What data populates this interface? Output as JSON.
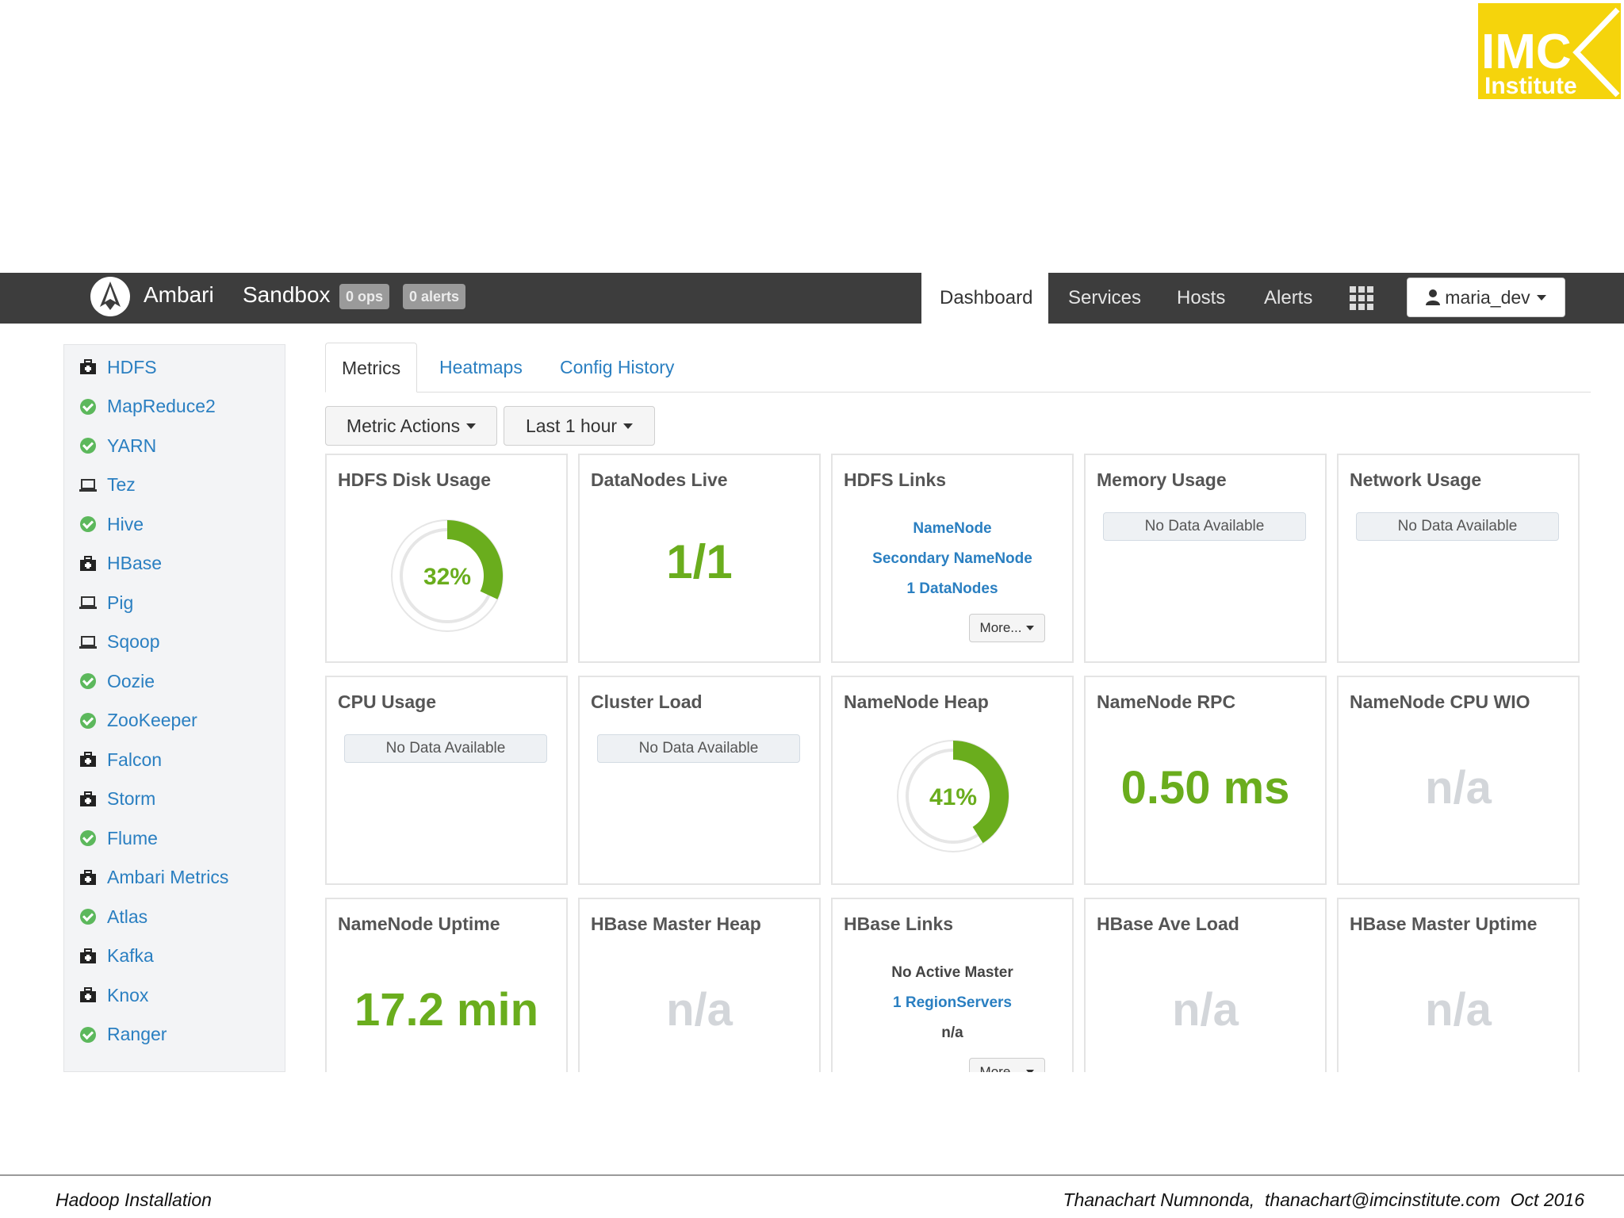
{
  "logo": {
    "line1": "IMC",
    "line2": "Institute",
    "color": "#f5d40c"
  },
  "navbar": {
    "brand": "Ambari",
    "cluster": "Sandbox",
    "ops_badge": "0 ops",
    "alerts_badge": "0 alerts",
    "links": [
      "Dashboard",
      "Services",
      "Hosts",
      "Alerts"
    ],
    "active": "Dashboard",
    "user": "maria_dev"
  },
  "sidebar": {
    "services": [
      {
        "name": "HDFS",
        "status": "maintenance"
      },
      {
        "name": "MapReduce2",
        "status": "ok"
      },
      {
        "name": "YARN",
        "status": "ok"
      },
      {
        "name": "Tez",
        "status": "client"
      },
      {
        "name": "Hive",
        "status": "ok"
      },
      {
        "name": "HBase",
        "status": "maintenance"
      },
      {
        "name": "Pig",
        "status": "client"
      },
      {
        "name": "Sqoop",
        "status": "client"
      },
      {
        "name": "Oozie",
        "status": "ok"
      },
      {
        "name": "ZooKeeper",
        "status": "ok"
      },
      {
        "name": "Falcon",
        "status": "maintenance"
      },
      {
        "name": "Storm",
        "status": "maintenance"
      },
      {
        "name": "Flume",
        "status": "ok"
      },
      {
        "name": "Ambari Metrics",
        "status": "maintenance"
      },
      {
        "name": "Atlas",
        "status": "ok"
      },
      {
        "name": "Kafka",
        "status": "maintenance"
      },
      {
        "name": "Knox",
        "status": "maintenance"
      },
      {
        "name": "Ranger",
        "status": "ok"
      }
    ]
  },
  "tabs": [
    "Metrics",
    "Heatmaps",
    "Config History"
  ],
  "toolbar": {
    "metric_actions": "Metric Actions",
    "time_range": "Last 1 hour"
  },
  "widgets": {
    "hdfs_disk": {
      "title": "HDFS Disk Usage",
      "value_label": "32%",
      "percent": 32
    },
    "datanodes": {
      "title": "DataNodes Live",
      "value": "1/1"
    },
    "hdfs_links": {
      "title": "HDFS Links",
      "links": [
        "NameNode",
        "Secondary NameNode",
        "1 DataNodes"
      ],
      "more": "More..."
    },
    "memory": {
      "title": "Memory Usage",
      "status": "No Data Available"
    },
    "network": {
      "title": "Network Usage",
      "status": "No Data Available"
    },
    "cpu": {
      "title": "CPU Usage",
      "status": "No Data Available"
    },
    "cluster_load": {
      "title": "Cluster Load",
      "status": "No Data Available"
    },
    "nn_heap": {
      "title": "NameNode Heap",
      "value_label": "41%",
      "percent": 41
    },
    "nn_rpc": {
      "title": "NameNode RPC",
      "value": "0.50 ms"
    },
    "nn_cpu_wio": {
      "title": "NameNode CPU WIO",
      "value": "n/a"
    },
    "nn_uptime": {
      "title": "NameNode Uptime",
      "value": "17.2 min"
    },
    "hbase_heap": {
      "title": "HBase Master Heap",
      "value": "n/a"
    },
    "hbase_links": {
      "title": "HBase Links",
      "lines": [
        "No Active Master",
        "1 RegionServers",
        "n/a"
      ],
      "more": "More..."
    },
    "hbase_load": {
      "title": "HBase Ave Load",
      "value": "n/a"
    },
    "hbase_uptime": {
      "title": "HBase Master Uptime",
      "value": "n/a"
    }
  },
  "colors": {
    "green": "#6aad1d",
    "link": "#2a7fc1",
    "na": "#d3d6da"
  },
  "footer": {
    "left": "Hadoop Installation",
    "right": "Thanachart Numnonda,  thanachart@imcinstitute.com  Oct 2016"
  }
}
